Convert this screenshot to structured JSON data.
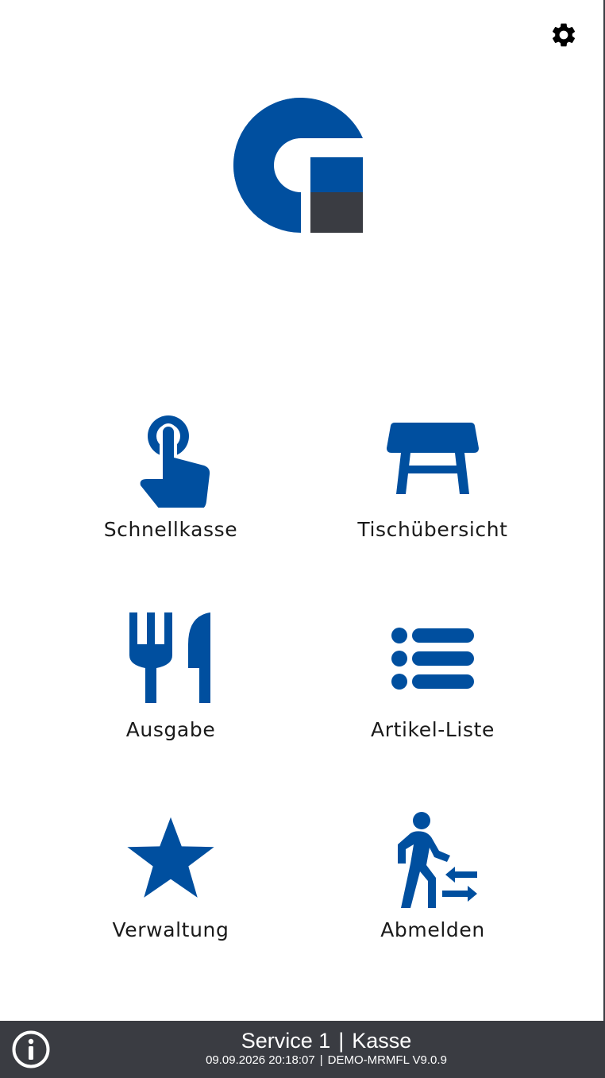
{
  "colors": {
    "brand_blue": "#004f9f",
    "brand_dark": "#3a3c42",
    "background": "#ffffff",
    "footer_text": "#ffffff"
  },
  "header": {
    "settings_icon": "gear-icon"
  },
  "logo": {
    "icon": "g-brand-logo"
  },
  "menu": {
    "items": [
      {
        "label": "Schnellkasse",
        "icon": "touch-finger-icon"
      },
      {
        "label": "Tischübersicht",
        "icon": "table-icon"
      },
      {
        "label": "Ausgabe",
        "icon": "fork-knife-icon"
      },
      {
        "label": "Artikel-Liste",
        "icon": "list-icon"
      },
      {
        "label": "Verwaltung",
        "icon": "star-icon"
      },
      {
        "label": "Abmelden",
        "icon": "walking-person-exchange-icon"
      }
    ]
  },
  "footer": {
    "info_icon": "info-circle-icon",
    "user": "Service 1",
    "register": "Kasse",
    "title_separator": "|",
    "datetime": "09.09.2026 20:18:07",
    "sub_separator": "|",
    "device_version": "DEMO-MRMFL V9.0.9"
  }
}
